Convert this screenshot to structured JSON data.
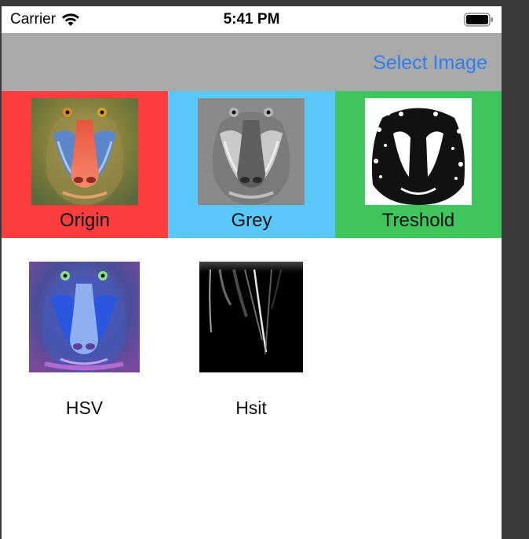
{
  "status_bar": {
    "carrier": "Carrier",
    "time": "5:41 PM"
  },
  "nav_bar": {
    "select_image_label": "Select Image",
    "background": "#a9a9a9",
    "accent": "#2f7ef2"
  },
  "tiles": [
    {
      "label": "Origin",
      "color": "#fc3d3d",
      "icon": "mandrill-color-image"
    },
    {
      "label": "Grey",
      "color": "#5ac8fa",
      "icon": "mandrill-grey-image"
    },
    {
      "label": "Treshold",
      "color": "#3ec55b",
      "icon": "mandrill-threshold-image"
    }
  ],
  "results": [
    {
      "label": "HSV",
      "icon": "mandrill-hsv-image"
    },
    {
      "label": "Hsit",
      "icon": "histogram-image"
    }
  ]
}
